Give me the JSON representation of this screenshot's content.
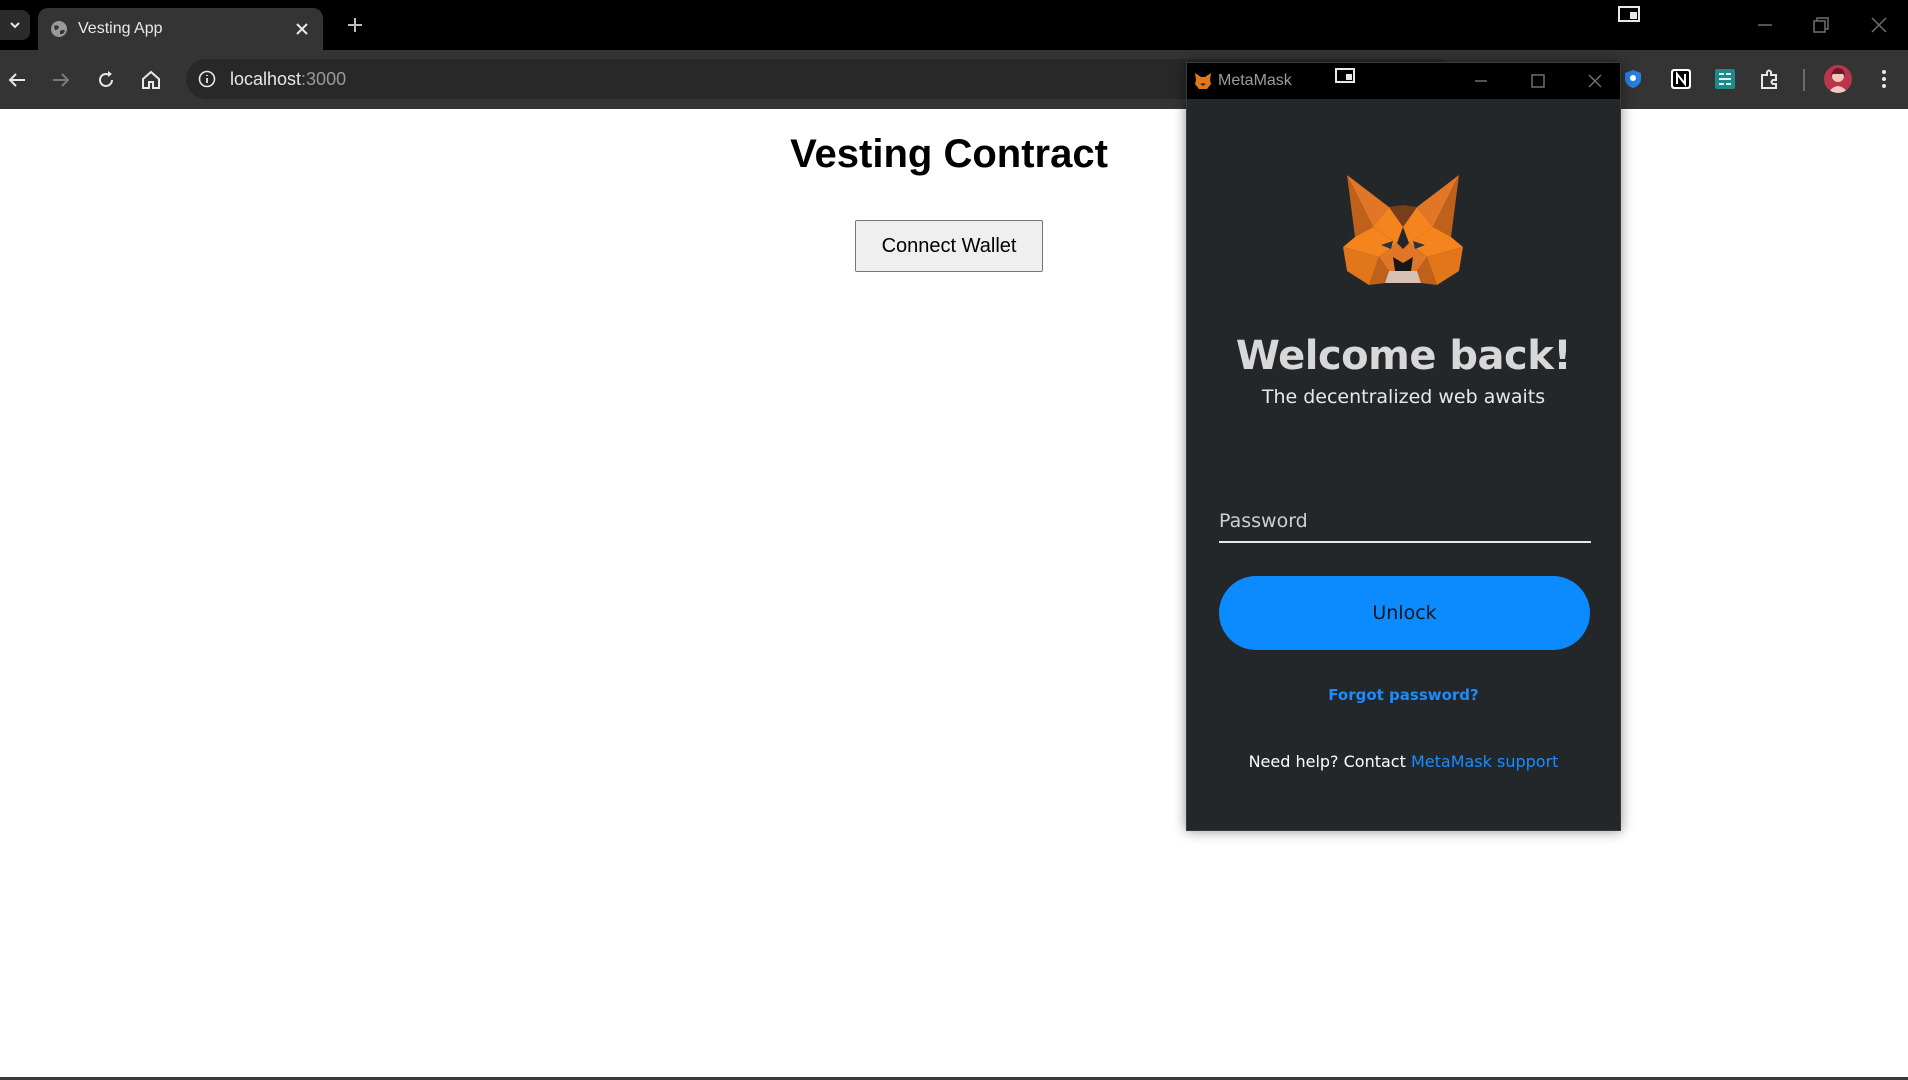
{
  "browser": {
    "tab": {
      "title": "Vesting App"
    },
    "address": {
      "host": "localhost",
      "port": ":3000"
    }
  },
  "page": {
    "title": "Vesting Contract",
    "connect_label": "Connect Wallet"
  },
  "metamask": {
    "window_title": "MetaMask",
    "welcome": "Welcome back!",
    "subtitle": "The decentralized web awaits",
    "password_placeholder": "Password",
    "unlock_label": "Unlock",
    "forgot_label": "Forgot password?",
    "help_prefix": "Need help? Contact",
    "help_link": "MetaMask support",
    "accent_color": "#0c8aff"
  }
}
